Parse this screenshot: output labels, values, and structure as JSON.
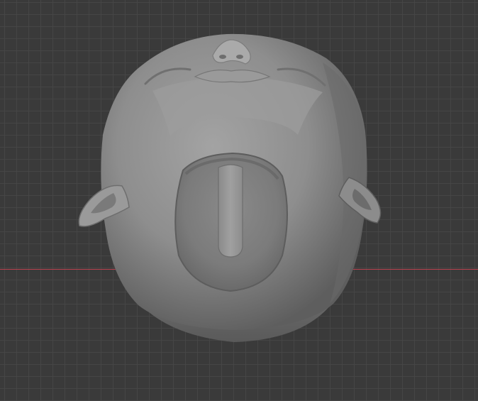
{
  "viewport": {
    "background": "#3a3a3a",
    "grid_color": "#474747",
    "x_axis_color": "#b8404e",
    "model_color": "#8f8f8f",
    "model_description_icon": "sculpt-mesh-head-icon"
  }
}
